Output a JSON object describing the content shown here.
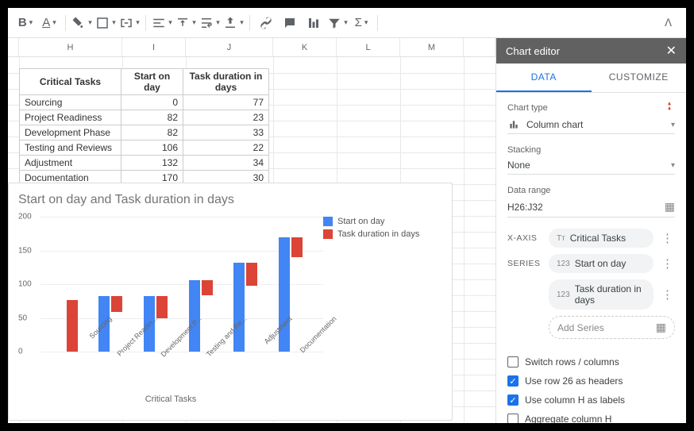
{
  "toolbar": {
    "icons": [
      "bold",
      "text-color",
      "fill-color",
      "borders",
      "merge",
      "align-h",
      "align-v",
      "wrap",
      "rotate",
      "link",
      "comment",
      "chart",
      "filter",
      "functions"
    ]
  },
  "columns": [
    "H",
    "I",
    "J",
    "K",
    "L",
    "M"
  ],
  "table": {
    "headers": [
      "Critical Tasks",
      "Start on day",
      "Task duration in days"
    ],
    "rows": [
      {
        "task": "Sourcing",
        "start": 0,
        "dur": 77
      },
      {
        "task": "Project Readiness",
        "start": 82,
        "dur": 23
      },
      {
        "task": "Development Phase",
        "start": 82,
        "dur": 33
      },
      {
        "task": "Testing and Reviews",
        "start": 106,
        "dur": 22
      },
      {
        "task": "Adjustment",
        "start": 132,
        "dur": 34
      },
      {
        "task": "Documentation",
        "start": 170,
        "dur": 30
      }
    ]
  },
  "chart_data": {
    "type": "bar",
    "title": "Start on day and Task duration in days",
    "xlabel": "Critical Tasks",
    "ylabel": "",
    "ylim": [
      0,
      200
    ],
    "yticks": [
      0,
      50,
      100,
      150,
      200
    ],
    "categories": [
      "Sourcing",
      "Project Readin...",
      "Development P...",
      "Testing and Re...",
      "Adjustment",
      "Documentation"
    ],
    "series": [
      {
        "name": "Start on day",
        "color": "#4285f4",
        "values": [
          0,
          82,
          82,
          106,
          132,
          170
        ]
      },
      {
        "name": "Task duration in days",
        "color": "#db4437",
        "values": [
          77,
          23,
          33,
          22,
          34,
          30
        ]
      }
    ]
  },
  "editor": {
    "title": "Chart editor",
    "tabs": {
      "data": "DATA",
      "customize": "CUSTOMIZE"
    },
    "chart_type": {
      "label": "Chart type",
      "value": "Column chart"
    },
    "stacking": {
      "label": "Stacking",
      "value": "None"
    },
    "data_range": {
      "label": "Data range",
      "value": "H26:J32"
    },
    "xaxis": {
      "label": "X-AXIS",
      "value": "Critical Tasks"
    },
    "series_label": "SERIES",
    "series": [
      "Start on day",
      "Task duration in days"
    ],
    "add_series": "Add Series",
    "checks": {
      "switch": "Switch rows / columns",
      "switch_v": false,
      "headers": "Use row 26 as headers",
      "headers_v": true,
      "labels": "Use column H as labels",
      "labels_v": true,
      "agg": "Aggregate column H",
      "agg_v": false
    }
  }
}
